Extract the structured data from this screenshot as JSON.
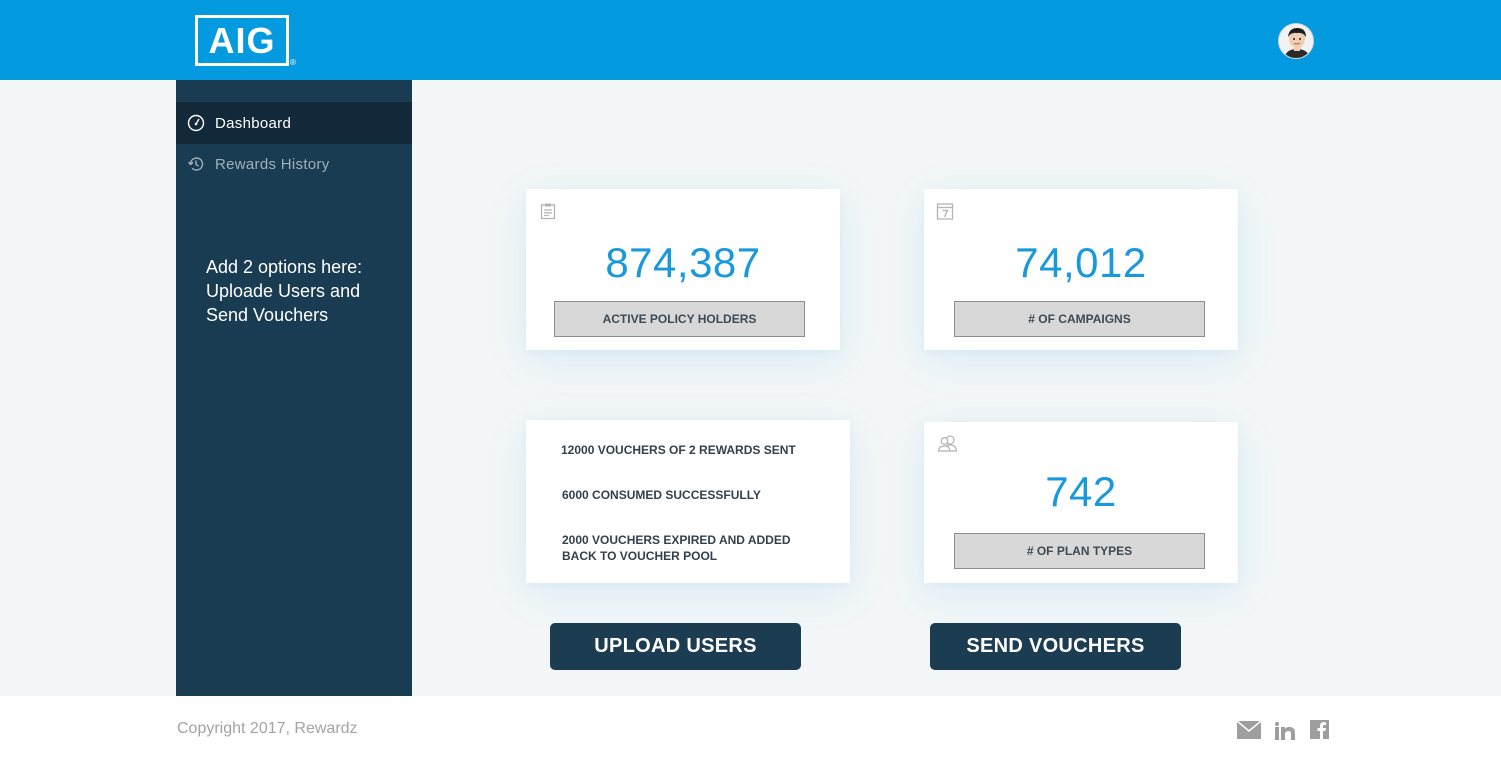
{
  "header": {
    "logo_text": "AIG",
    "logo_mark": "®",
    "brand_color": "#039ae0",
    "avatar_icon": "user-avatar"
  },
  "sidebar": {
    "items": [
      {
        "label": "Dashboard",
        "icon": "dashboard-gauge-icon",
        "active": true
      },
      {
        "label": "Rewards History",
        "icon": "history-icon",
        "active": false
      }
    ],
    "note": "Add 2 options here: Uploade Users and Send Vouchers"
  },
  "cards": {
    "policy_holders": {
      "value": "874,387",
      "label": "ACTIVE POLICY HOLDERS",
      "icon": "clipboard-icon"
    },
    "campaigns": {
      "value": "74,012",
      "label": "# OF CAMPAIGNS",
      "icon": "calendar-icon"
    },
    "vouchers": {
      "lines": [
        "12000 VOUCHERS OF 2 REWARDS SENT",
        "6000 CONSUMED SUCCESSFULLY",
        "2000 VOUCHERS EXPIRED AND ADDED BACK TO VOUCHER POOL"
      ]
    },
    "plan_types": {
      "value": "742",
      "label": "# OF PLAN TYPES",
      "icon": "users-icon"
    }
  },
  "actions": {
    "upload_label": "UPLOAD USERS",
    "send_label": "SEND VOUCHERS"
  },
  "footer": {
    "copyright": "Copyright 2017, Rewardz",
    "social": [
      "mail-icon",
      "linkedin-icon",
      "facebook-icon"
    ]
  }
}
